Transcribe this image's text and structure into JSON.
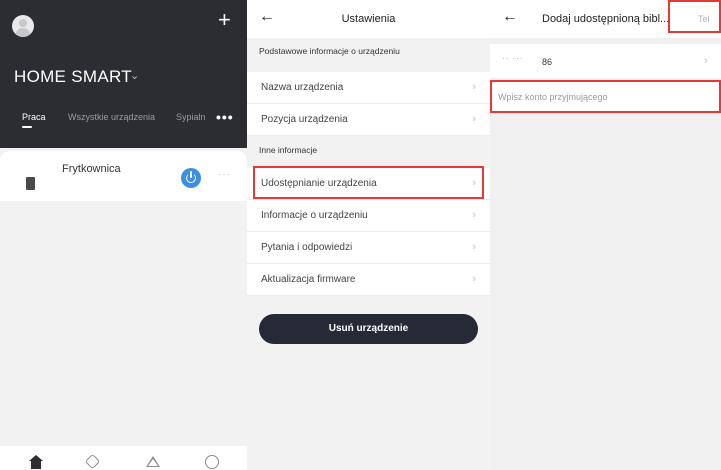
{
  "panel_home": {
    "title": "HOME SMART",
    "title_chevron": "⌄",
    "add_glyph": "+",
    "more_glyph": "•••",
    "tabs": [
      {
        "label": "Praca",
        "active": true
      },
      {
        "label": "Wszystkie urządzenia",
        "active": false
      },
      {
        "label": "Sypialn",
        "active": false
      }
    ],
    "devices": [
      {
        "name": "Frytkownica",
        "power": "on",
        "more_glyph": "···"
      }
    ],
    "nav": [
      "home-icon",
      "smart-icon",
      "scene-icon",
      "profile-icon"
    ]
  },
  "panel_settings": {
    "back_glyph": "←",
    "title": "Ustawienia",
    "section_basic": "Podstawowe informacje o urządzeniu",
    "basic_items": [
      {
        "label": "Nazwa urządzenia",
        "chevron": "›"
      },
      {
        "label": "Pozycja urządzenia",
        "chevron": "›"
      }
    ],
    "section_other": "Inne informacje",
    "other_items": [
      {
        "label": "Udostępnianie urządzenia",
        "chevron": "›",
        "highlighted": true
      },
      {
        "label": "Informacje o urządzeniu",
        "chevron": "›"
      },
      {
        "label": "Pytania i odpowiedzi",
        "chevron": "›"
      },
      {
        "label": "Aktualizacja firmware",
        "chevron": "›"
      }
    ],
    "delete_button": "Usuń urządzenie"
  },
  "panel_share": {
    "back_glyph": "←",
    "title": "Dodaj udostępnioną bibl...",
    "action_label": "Tel",
    "country_prefix": "·· ···",
    "country_code": "86",
    "code_chevron": "›",
    "account_placeholder": "Wpisz konto przyjmującego",
    "account_value": ""
  },
  "colors": {
    "header_dark": "#2b2d33",
    "power_blue": "#3d8fe0",
    "highlight_red": "#e53935",
    "delete_button_bg": "#262a36"
  }
}
